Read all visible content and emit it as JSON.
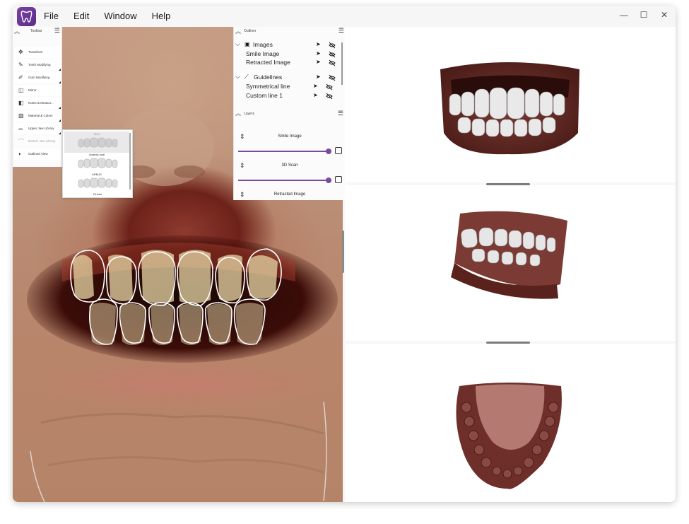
{
  "app": {
    "menu": [
      "File",
      "Edit",
      "Window",
      "Help"
    ],
    "window_controls": {
      "minimize": "—",
      "maximize": "☐",
      "close": "✕"
    }
  },
  "toolbar": {
    "title": "Toolbar",
    "items": [
      {
        "label": "Transform",
        "icon": "move-icon"
      },
      {
        "label": "Tooth Modifying",
        "icon": "tooth-edit-icon"
      },
      {
        "label": "Gum Modifying",
        "icon": "gum-edit-icon"
      },
      {
        "label": "Mirror",
        "icon": "mirror-icon"
      },
      {
        "label": "Notes & Measur...",
        "icon": "notes-icon"
      },
      {
        "label": "Material & Colors",
        "icon": "palette-icon"
      },
      {
        "label": "Upper Jaw Library",
        "icon": "upper-jaw-icon"
      },
      {
        "label": "Bottom Jaw Library",
        "icon": "bottom-jaw-icon"
      },
      {
        "label": "Outlined View",
        "icon": "outline-view-icon"
      }
    ]
  },
  "library": {
    "items": [
      "Anatoly-oval",
      "ARBUS",
      "Pinbito"
    ],
    "top_label": "MLB"
  },
  "outliner": {
    "title": "Outliner",
    "groups": [
      {
        "label": "Images",
        "children": [
          "Smile Image",
          "Retracted Image"
        ]
      },
      {
        "label": "Guidelines",
        "children": [
          "Symmetrical line",
          "Custom line 1"
        ]
      }
    ]
  },
  "layers": {
    "title": "Layers",
    "items": [
      {
        "label": "Smile Image",
        "opacity": 1.0
      },
      {
        "label": "3D Scan",
        "opacity": 1.0
      },
      {
        "label": "Retracted Image",
        "opacity": 1.0
      }
    ]
  },
  "colors": {
    "accent": "#7a4aa0",
    "app_logo": "#6b35a0"
  }
}
